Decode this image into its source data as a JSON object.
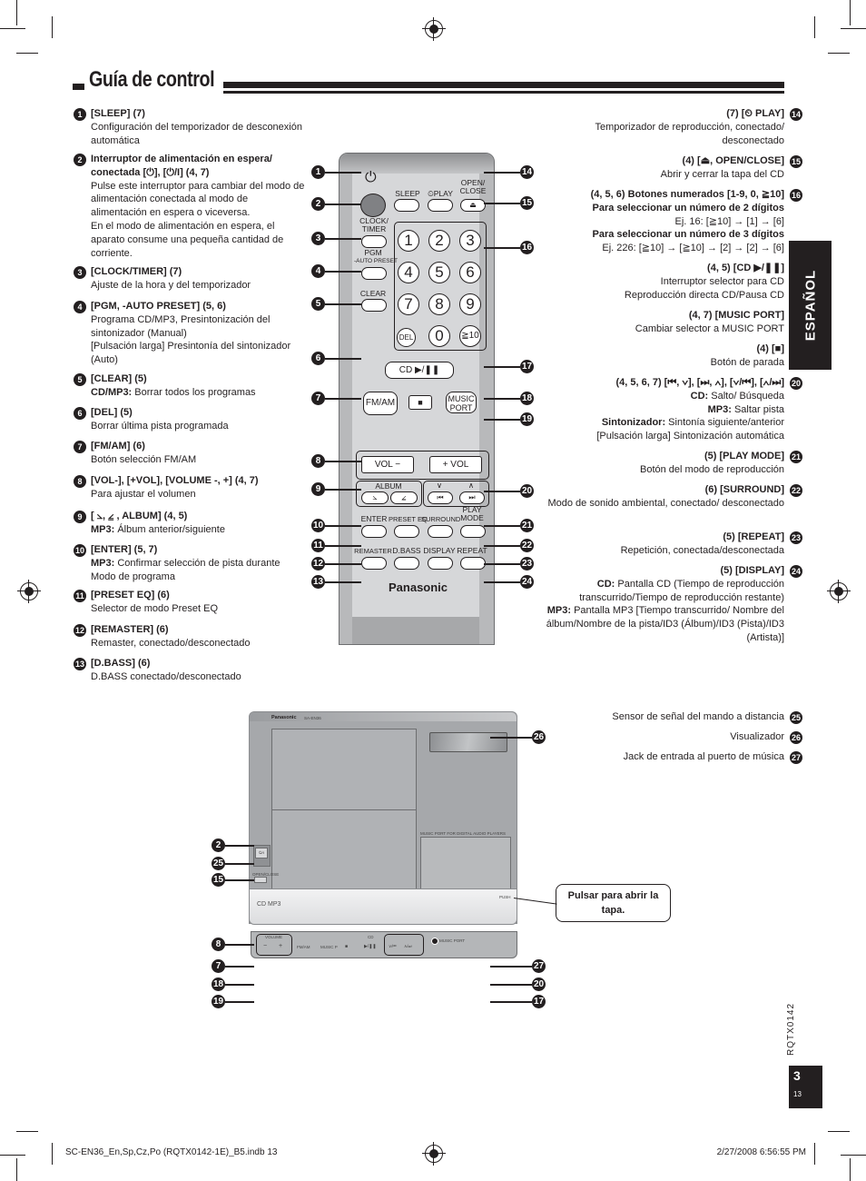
{
  "page": {
    "title": "Guía de control",
    "side_tab": "ESPAÑOL",
    "doc_code": "RQTX0142",
    "page_number": "3",
    "page_sub_number": "13",
    "footer_left": "SC-EN36_En,Sp,Cz,Po (RQTX0142-1E)_B5.indb   13",
    "footer_right": "2/27/2008   6:56:55 PM"
  },
  "left_items": [
    {
      "n": "1",
      "head": "[SLEEP] (7)",
      "lines": [
        "Configuración del temporizador de desconexión automática"
      ]
    },
    {
      "n": "2",
      "head": "Interruptor de alimentación en espera/ conectada [⏻], [⏻/I] (4, 7)",
      "lines": [
        "Pulse este interruptor para cambiar del modo de alimentación conectada al modo de alimentación en espera o viceversa.",
        "En el modo de alimentación en espera, el aparato consume una pequeña cantidad de corriente."
      ]
    },
    {
      "n": "3",
      "head": "[CLOCK/TIMER] (7)",
      "lines": [
        "Ajuste de la hora y del temporizador"
      ]
    },
    {
      "n": "4",
      "head": "[PGM, -AUTO PRESET] (5, 6)",
      "lines": [
        "Programa CD/MP3, Presintonización del sintonizador (Manual)",
        "[Pulsación larga] Presintonía del sintonizador (Auto)"
      ]
    },
    {
      "n": "5",
      "head": "[CLEAR] (5)",
      "bold_prefix": "CD/MP3:",
      "lines": [
        "Borrar todos los programas"
      ]
    },
    {
      "n": "6",
      "head": "[DEL] (5)",
      "lines": [
        "Borrar última pista programada"
      ]
    },
    {
      "n": "7",
      "head": "[FM/AM] (6)",
      "lines": [
        "Botón selección FM/AM"
      ]
    },
    {
      "n": "8",
      "head": "[VOL-], [+VOL], [VOLUME -, +] (4, 7)",
      "lines": [
        "Para ajustar el volumen"
      ]
    },
    {
      "n": "9",
      "head": "[ ⦣, ⦤ , ALBUM] (4, 5)",
      "bold_prefix": "MP3:",
      "lines": [
        "Álbum anterior/siguiente"
      ]
    },
    {
      "n": "10",
      "head": "[ENTER] (5, 7)",
      "bold_prefix": "MP3:",
      "lines": [
        "Confirmar selección de pista durante Modo de programa"
      ]
    },
    {
      "n": "11",
      "head": "[PRESET EQ] (6)",
      "lines": [
        "Selector de modo Preset EQ"
      ]
    },
    {
      "n": "12",
      "head": "[REMASTER] (6)",
      "lines": [
        "Remaster, conectado/desconectado"
      ]
    },
    {
      "n": "13",
      "head": "[D.BASS] (6)",
      "lines": [
        "D.BASS conectado/desconectado"
      ]
    }
  ],
  "right_items": [
    {
      "n": "14",
      "head": "(7) [⏲ PLAY]",
      "lines": [
        "Temporizador de reproducción, conectado/ desconectado"
      ]
    },
    {
      "n": "15",
      "head": "(4) [⏏, OPEN/CLOSE]",
      "lines": [
        "Abrir y cerrar la tapa del CD"
      ]
    },
    {
      "n": "16",
      "head": "(4, 5, 6) Botones numerados [1-9, 0, ≧10]",
      "lines": [
        "<b>Para seleccionar un número de 2 dígitos</b>",
        "Ej. 16: [≧10] → [1] → [6]",
        "<b>Para seleccionar un número de 3 dígitos</b>",
        "Ej. 226: [≧10] → [≧10] → [2] → [2] → [6]"
      ]
    },
    {
      "n": "17",
      "head": "(4, 5) [CD ▶/❚❚]",
      "lines": [
        "Interruptor selector para CD",
        "Reproducción directa CD/Pausa CD"
      ]
    },
    {
      "n": "18",
      "head": "(4, 7) [MUSIC PORT]",
      "lines": [
        "Cambiar selector a MUSIC PORT"
      ]
    },
    {
      "n": "19",
      "head": "(4) [■]",
      "lines": [
        "Botón de parada"
      ]
    },
    {
      "n": "20",
      "head": "(4, 5, 6, 7) [⏮, ∨], [⏭, ∧], [∨/⏮], [∧/⏭]",
      "lines": [
        "<b>CD:</b> Salto/ Búsqueda",
        "<b>MP3:</b> Saltar pista",
        "<b>Sintonizador:</b> Sintonía siguiente/anterior",
        "[Pulsación larga] Sintonización automática"
      ]
    },
    {
      "n": "21",
      "head": "(5) [PLAY MODE]",
      "lines": [
        "Botón del modo de reproducción"
      ]
    },
    {
      "n": "22",
      "head": "(6) [SURROUND]",
      "lines": [
        "Modo de sonido ambiental, conectado/ desconectado"
      ]
    },
    {
      "n": "23",
      "head": "(5) [REPEAT]",
      "lines": [
        "Repetición, conectada/desconectada"
      ]
    },
    {
      "n": "24",
      "head": "(5) [DISPLAY]",
      "lines": [
        "<b>CD:</b> Pantalla CD (Tiempo de reproducción transcurrido/Tiempo de reproducción restante)",
        "<b>MP3:</b> Pantalla MP3 [Tiempo transcurrido/ Nombre del álbum/Nombre de la pista/ID3 (Álbum)/ID3 (Pista)/ID3 (Artista)]"
      ]
    }
  ],
  "device_items": [
    {
      "n": "25",
      "text": "Sensor de señal del mando a distancia"
    },
    {
      "n": "26",
      "text": "Visualizador"
    },
    {
      "n": "27",
      "text": "Jack de entrada al puerto de música"
    }
  ],
  "callout_note": "Pulsar para abrir la tapa.",
  "remote": {
    "brand": "Panasonic",
    "labels": {
      "power": "⏻",
      "sleep": "SLEEP",
      "play_timer": "⏲PLAY",
      "open_close": "OPEN/ CLOSE",
      "eject": "⏏",
      "clock_timer": "CLOCK/ TIMER",
      "pgm": "PGM",
      "auto_preset": "-AUTO PRESET",
      "clear": "CLEAR",
      "del": "DEL",
      "cd_play_pause": "CD ▶/❚❚",
      "fm_am": "FM/AM",
      "stop": "■",
      "music_port": "MUSIC PORT",
      "vol_down": "VOL −",
      "vol_up": "+ VOL",
      "album": "ALBUM",
      "album_prev": "⦣",
      "album_next": "⦤",
      "skip_down_arrow": "∨",
      "skip_up_arrow": "∧",
      "skip_prev": "⏮",
      "skip_next": "⏭",
      "enter": "ENTER",
      "preset_eq": "PRESET EQ",
      "surround": "SURROUND",
      "play_mode": "PLAY MODE",
      "remaster": "REMASTER",
      "dbass": "D.BASS",
      "display": "DISPLAY",
      "repeat": "REPEAT"
    },
    "number_keys": [
      "1",
      "2",
      "3",
      "4",
      "5",
      "6",
      "7",
      "8",
      "9",
      "0",
      "≧10"
    ]
  },
  "device": {
    "brand": "Panasonic",
    "model": "SA-EN36",
    "music_port_label": "MUSIC PORT FOR DIGITAL AUDIO PLAYERS",
    "front_logos": "CD MP3",
    "push_label": "PUSH",
    "open_close_label": "OPEN/CLOSE",
    "power_label": "⏻/I",
    "strip_volume": "VOLUME",
    "strip_minus": "−",
    "strip_plus": "+",
    "strip_fm_am": "FM/AM",
    "strip_music_p": "MUSIC P",
    "strip_stop": "■",
    "strip_cd": "CD",
    "strip_play_pause": "▶/❚❚",
    "strip_skip_down": "∨/⏮",
    "strip_skip_up": "∧/⏭",
    "strip_music_port": "MUSIC PORT"
  }
}
